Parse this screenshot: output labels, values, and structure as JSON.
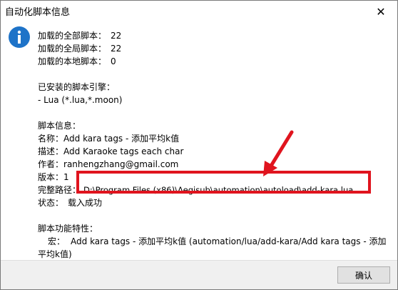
{
  "window": {
    "title": "自动化脚本信息",
    "close_glyph": "✕"
  },
  "summary": {
    "loaded_all_label": "加载的全部脚本：",
    "loaded_all_value": "22",
    "loaded_global_label": "加载的全局脚本：",
    "loaded_global_value": "22",
    "loaded_local_label": "加载的本地脚本：",
    "loaded_local_value": "0"
  },
  "engines": {
    "heading": "已安装的脚本引擎：",
    "items": [
      "- Lua (*.lua,*.moon)"
    ]
  },
  "script_info": {
    "heading": "脚本信息：",
    "name_label": "名称：",
    "name_value": "Add kara tags - 添加平均k值",
    "desc_label": "描述：",
    "desc_value": "Add Karaoke tags each char",
    "author_label": "作者：",
    "author_value": "ranhengzhang@gmail.com",
    "version_label": "版本：",
    "version_value": "1",
    "path_label": "完整路径：",
    "path_value": "D:\\Program Files (x86)\\Aegisub\\automation\\autoload\\add-kara.lua",
    "status_label": "状态：",
    "status_value": "载入成功"
  },
  "features": {
    "heading": "脚本功能特性：",
    "macro_label": "宏：",
    "macro_value_line1": "Add kara tags - 添加平均k值 (automation/lua/add-kara/Add kara tags - 添加",
    "macro_value_line2": "平均k值)"
  },
  "footer": {
    "ok_label": "确认"
  },
  "colors": {
    "highlight": "#e0141e",
    "info_icon": "#1e73c8"
  }
}
